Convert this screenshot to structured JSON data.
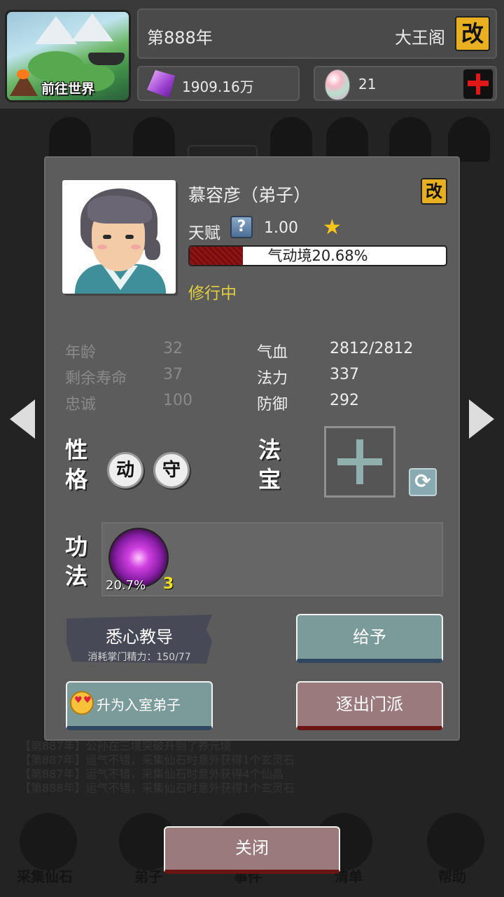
{
  "hud": {
    "world_button_label": "前往世界",
    "year": "第888年",
    "sect_name": "大王阁",
    "edit_label": "改",
    "spirit_stones": "1909.16万",
    "spirit_eggs": "21"
  },
  "background": {
    "log_lines": [
      "【第887年】公孙在三境突破升到了养元境",
      "【第887年】运气不错，采集仙石时意外获得1个玄灵石",
      "【第887年】运气不错，采集仙石时意外获得4个仙晶",
      "【第888年】运气不错，采集仙石时意外获得1个玄灵石"
    ],
    "bottom_nav": [
      "采集仙石",
      "弟子",
      "事件",
      "清单",
      "帮助"
    ]
  },
  "disciple": {
    "name": "慕容彦（弟子）",
    "edit_label": "改",
    "talent_label": "天赋",
    "talent_help": "?",
    "talent_value": "1.00",
    "talent_star": "★",
    "realm_progress_text": "气动境20.68%",
    "realm_progress": 0.2068,
    "status": "修行中",
    "stats_left": [
      {
        "label": "年龄",
        "value": "32"
      },
      {
        "label": "剩余寿命",
        "value": "37"
      },
      {
        "label": "忠诚",
        "value": "100"
      }
    ],
    "stats_right": [
      {
        "label": "气血",
        "value": "2812/2812"
      },
      {
        "label": "法力",
        "value": "337"
      },
      {
        "label": "防御",
        "value": "292"
      }
    ],
    "personality_title": [
      "性",
      "格"
    ],
    "traits": [
      "动",
      "守"
    ],
    "artifact_title": [
      "法",
      "宝"
    ],
    "skills_title": [
      "功",
      "法"
    ],
    "skill": {
      "progress": "20.7%",
      "level": "3"
    }
  },
  "actions": {
    "teach": "悉心教导",
    "teach_cost": "消耗掌门精力：150/77",
    "give": "给予",
    "promote": "升为入室弟子",
    "expel": "逐出门派",
    "close": "关闭"
  },
  "colors": {
    "gold_button": "#e8b020",
    "status_yellow": "#e0d040",
    "progress_fill": "#7a0c0c",
    "teal_button": "#7b9a9a",
    "red_button": "#9a7a7c"
  }
}
